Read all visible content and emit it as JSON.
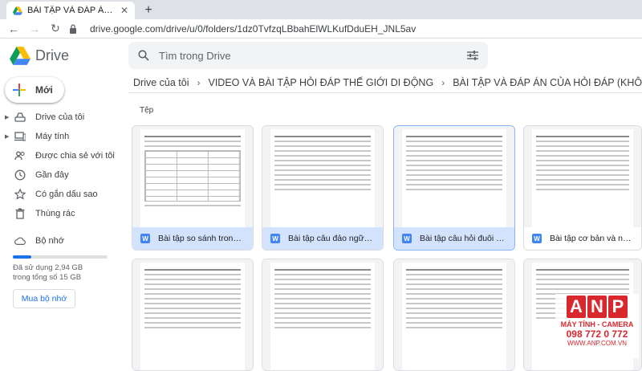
{
  "browser": {
    "tab_title": "BÀI TẬP VÀ ĐÁP ÁN CỦA HỎI ĐÁ",
    "url": "drive.google.com/drive/u/0/folders/1dz0TvfzqLBbahElWLKufDduEH_JNL5av"
  },
  "header": {
    "app_name": "Drive",
    "search_placeholder": "Tìm trong Drive"
  },
  "sidebar": {
    "new_label": "Mới",
    "items": [
      {
        "label": "Drive của tôi",
        "icon": "drive-icon"
      },
      {
        "label": "Máy tính",
        "icon": "computer-icon"
      },
      {
        "label": "Được chia sẻ với tôi",
        "icon": "people-icon"
      },
      {
        "label": "Gần đây",
        "icon": "clock-icon"
      },
      {
        "label": "Có gắn dấu sao",
        "icon": "star-icon"
      },
      {
        "label": "Thùng rác",
        "icon": "trash-icon"
      }
    ],
    "storage_label": "Bộ nhớ",
    "storage_text": "Đã sử dụng 2,94 GB trong tổng số 15 GB",
    "storage_fraction": 0.196,
    "buy_label": "Mua bộ nhớ"
  },
  "breadcrumbs": [
    "Drive của tôi",
    "VIDEO VÀ BÀI TẬP HỎI ĐÁP THẾ GIỚI DI ĐỘNG",
    "BÀI TẬP VÀ ĐÁP ÁN CỦA HỎI ĐÁP (KHÔNG ĐƯỢC XÓA)"
  ],
  "section_label": "Tệp",
  "files": [
    {
      "name": "Bài tập so sánh trong tiếng A..."
    },
    {
      "name": "Bài tập câu đảo ngữ trong tiế..."
    },
    {
      "name": "Bài tập câu hỏi đuôi trong tiế..."
    },
    {
      "name": "Bài tập cơ bản và nâng cao v..."
    }
  ],
  "watermark": {
    "letters": [
      "A",
      "N",
      "P"
    ],
    "tagline": "MÁY TÍNH - CAMERA",
    "phone": "098 772 0 772",
    "site": "WWW.ANP.COM.VN"
  },
  "colors": {
    "accent": "#1a73e8",
    "selected_bg": "#d3e3fd",
    "watermark": "#d8282e"
  }
}
